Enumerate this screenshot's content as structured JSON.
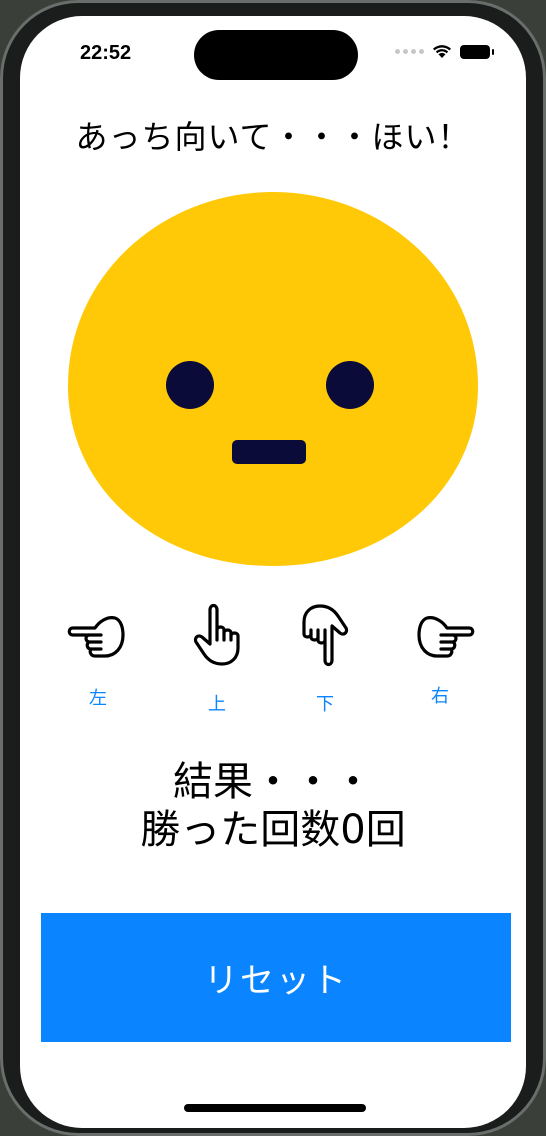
{
  "status_bar": {
    "time": "22:52",
    "icons": [
      "signal-dots-icon",
      "wifi-icon",
      "battery-icon"
    ]
  },
  "title": "あっち向いて・・・ほい！",
  "face": {
    "icon": "neutral-face-icon",
    "color": "#FFC907",
    "feature_color": "#0B0B3A"
  },
  "directions": [
    {
      "label": "左",
      "icon": "pointing-left-icon"
    },
    {
      "label": "上",
      "icon": "pointing-up-icon"
    },
    {
      "label": "下",
      "icon": "pointing-down-icon"
    },
    {
      "label": "右",
      "icon": "pointing-right-icon"
    }
  ],
  "result": {
    "line1": "結果・・・",
    "line2": "勝った回数0回"
  },
  "reset_button": {
    "label": "リセット",
    "color": "#0A84FF"
  }
}
